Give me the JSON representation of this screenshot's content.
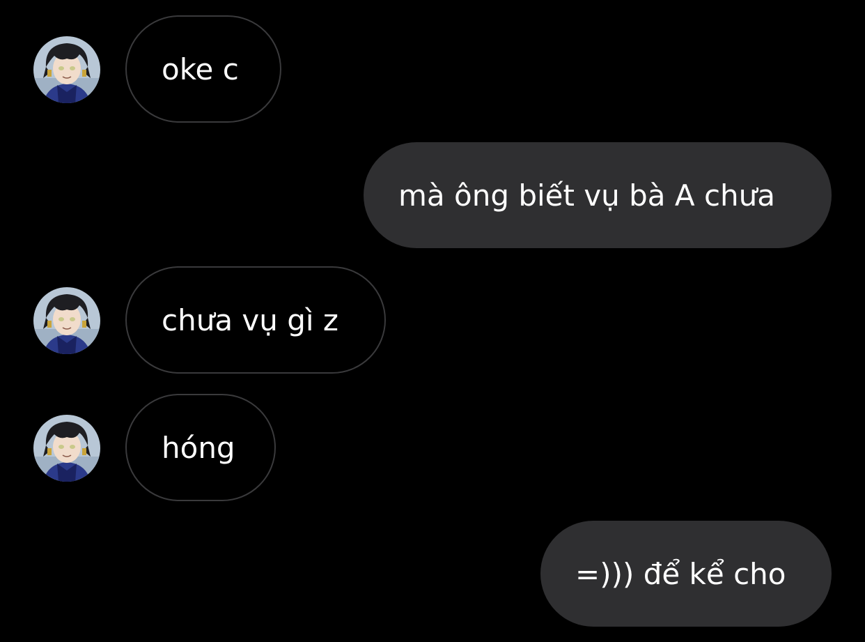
{
  "colors": {
    "background": "#000000",
    "incoming_border": "#3a3a3c",
    "outgoing_fill": "#2f2f31",
    "text": "#ffffff"
  },
  "messages": [
    {
      "direction": "incoming",
      "text": "oke c",
      "has_avatar": true
    },
    {
      "direction": "outgoing",
      "text": "mà ông biết vụ bà A chưa"
    },
    {
      "direction": "incoming",
      "text": "chưa vụ gì z",
      "has_avatar": true
    },
    {
      "direction": "incoming",
      "text": "hóng",
      "has_avatar": true
    },
    {
      "direction": "outgoing",
      "text": "=))) để kể cho"
    }
  ]
}
